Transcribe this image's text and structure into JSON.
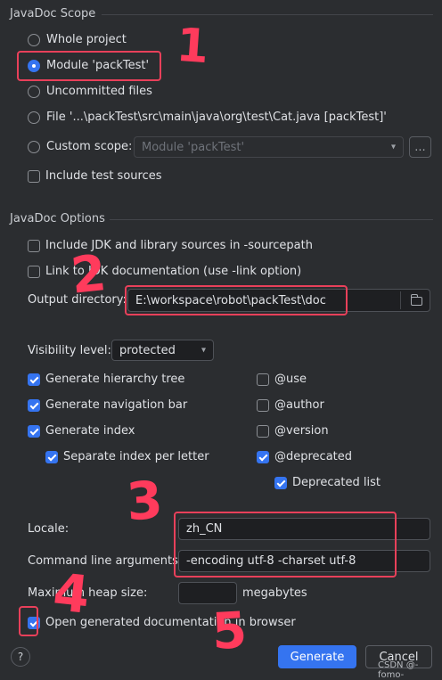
{
  "scope": {
    "title": "JavaDoc Scope",
    "options": {
      "whole_project": "Whole project",
      "module": "Module 'packTest'",
      "uncommitted": "Uncommitted files",
      "file": "File '...\\packTest\\src\\main\\java\\org\\test\\Cat.java [packTest]'",
      "custom": "Custom scope:"
    },
    "custom_scope_value": "Module 'packTest'",
    "custom_scope_more": "...",
    "include_test_sources": "Include test sources"
  },
  "options": {
    "title": "JavaDoc Options",
    "include_jdk": "Include JDK and library sources in -sourcepath",
    "link_jdk": "Link to JDK documentation (use -link option)",
    "output_dir_label": "Output directory:",
    "output_dir_value": "E:\\workspace\\robot\\packTest\\doc",
    "visibility_label": "Visibility level:",
    "visibility_value": "protected",
    "gen_hierarchy": "Generate hierarchy tree",
    "gen_nav": "Generate navigation bar",
    "gen_index": "Generate index",
    "sep_index": "Separate index per letter",
    "use": "@use",
    "author": "@author",
    "version": "@version",
    "deprecated": "@deprecated",
    "deprecated_list": "Deprecated list",
    "locale_label": "Locale:",
    "locale_value": "zh_CN",
    "cmd_label": "Command line arguments:",
    "cmd_value": "-encoding utf-8 -charset utf-8",
    "heap_label": "Maximum heap size:",
    "heap_value": "",
    "heap_unit": "megabytes",
    "open_browser": "Open generated documentation in browser"
  },
  "footer": {
    "help": "?",
    "generate": "Generate",
    "cancel": "Cancel",
    "watermark": "CSDN @-fomo-"
  },
  "annotations": [
    "1",
    "2",
    "3",
    "4",
    "5"
  ],
  "colors": {
    "accent": "#3574f0",
    "highlight": "#e8405a"
  }
}
